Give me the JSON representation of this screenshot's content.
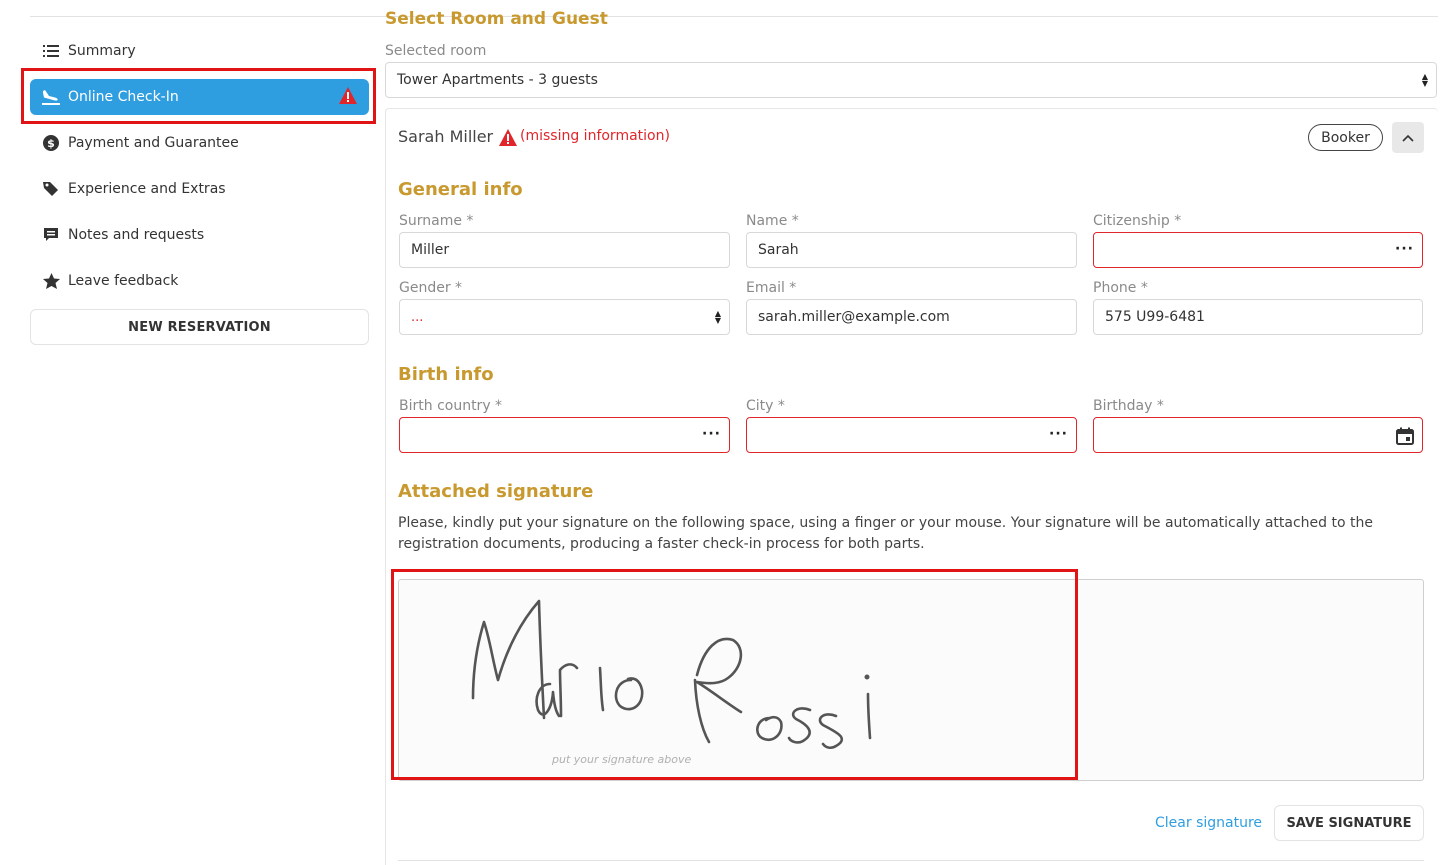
{
  "sidebar": {
    "items": [
      {
        "label": "Summary",
        "icon": "list-icon"
      },
      {
        "label": "Online Check-In",
        "icon": "plane-landing-icon",
        "active": true,
        "warning": true
      },
      {
        "label": "Payment and Guarantee",
        "icon": "dollar-circle-icon"
      },
      {
        "label": "Experience and Extras",
        "icon": "tags-icon"
      },
      {
        "label": "Notes and requests",
        "icon": "comment-icon"
      },
      {
        "label": "Leave feedback",
        "icon": "star-icon"
      }
    ],
    "new_reservation": "NEW RESERVATION"
  },
  "main": {
    "section_title": "Select Room and Guest",
    "selected_room_label": "Selected room",
    "selected_room_value": "Tower Apartments - 3 guests",
    "guest": {
      "name": "Sarah Miller",
      "missing": "(missing information)",
      "badge": "Booker"
    },
    "general_info": {
      "title": "General info",
      "surname_label": "Surname *",
      "surname_value": "Miller",
      "name_label": "Name *",
      "name_value": "Sarah",
      "citizenship_label": "Citizenship *",
      "citizenship_value": "",
      "gender_label": "Gender *",
      "gender_value": "...",
      "email_label": "Email *",
      "email_value": "sarah.miller@example.com",
      "phone_label": "Phone *",
      "phone_value": "575 U99-6481"
    },
    "birth_info": {
      "title": "Birth info",
      "country_label": "Birth country *",
      "city_label": "City *",
      "birthday_label": "Birthday *"
    },
    "signature": {
      "title": "Attached signature",
      "instructions": "Please, kindly put your signature on the following space, using a finger or your mouse. Your signature will be automatically attached to the registration documents, producing a faster check-in process for both parts.",
      "hint": "put your signature above",
      "clear_label": "Clear signature",
      "save_label": "SAVE SIGNATURE"
    }
  },
  "colors": {
    "accent": "#2f9ee0",
    "section_title": "#c8992e",
    "error": "#e0262b",
    "highlight": "#e01414"
  }
}
